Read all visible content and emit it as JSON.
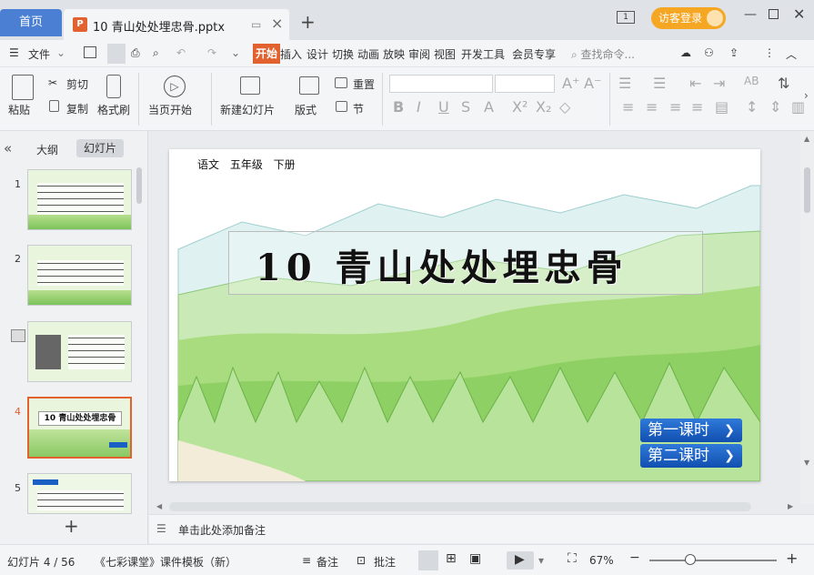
{
  "titlebar": {
    "home_tab": "首页",
    "doc_tab": "10 青山处处埋忠骨.pptx",
    "doc_icon": "P",
    "screen_label": "1",
    "login_label": "访客登录"
  },
  "menu": {
    "file": "文件",
    "tabs": [
      "开始",
      "插入",
      "设计",
      "切换",
      "动画",
      "放映",
      "审阅",
      "视图",
      "开发工具",
      "会员专享"
    ],
    "search_placeholder": "查找命令..."
  },
  "ribbon": {
    "paste": "粘贴",
    "cut": "剪切",
    "copy": "复制",
    "format_painter": "格式刷",
    "from_current": "当页开始",
    "new_slide": "新建幻灯片",
    "layout": "版式",
    "reset": "重置",
    "section": "节"
  },
  "left_panel": {
    "outline_tab": "大纲",
    "slides_tab": "幻灯片",
    "slide_numbers": [
      "1",
      "2",
      "3",
      "4",
      "5"
    ],
    "thumb4_title": "10 青山处处埋忠骨"
  },
  "slide": {
    "header": "语文   五年级   下册",
    "title": "10 青山处处埋忠骨",
    "lesson1": "第一课时",
    "lesson2": "第二课时"
  },
  "notes_placeholder": "单击此处添加备注",
  "status": {
    "slide_counter": "幻灯片 4 / 56",
    "template": "《七彩课堂》课件模板（新）",
    "notes_btn": "备注",
    "comment_btn": "批注",
    "zoom": "67%",
    "zoom_level": 0.33
  },
  "colors": {
    "accent": "#e2622f",
    "home_tab": "#4a7fd4",
    "login": "#f5a623",
    "lesson_button": "#1a5fc4"
  }
}
